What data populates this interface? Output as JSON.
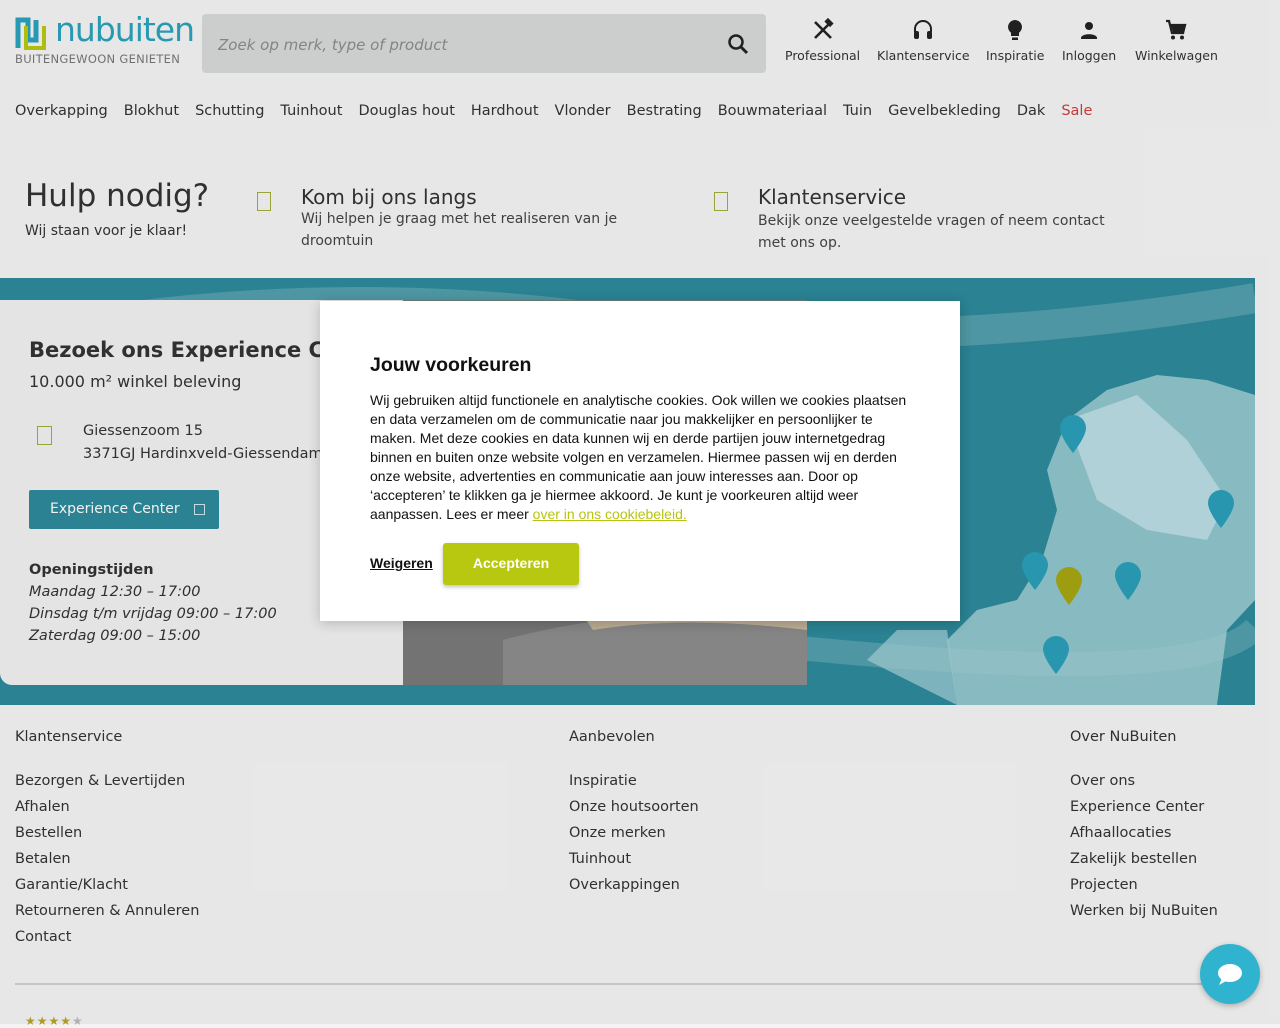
{
  "header": {
    "logo_text": "nubuiten",
    "logo_tagline": "BUITENGEWOON GENIETEN",
    "search_placeholder": "Zoek op merk, type of product",
    "items": [
      {
        "label": "Professional",
        "icon": "tools-icon"
      },
      {
        "label": "Klantenservice",
        "icon": "headset-icon"
      },
      {
        "label": "Inspiratie",
        "icon": "lightbulb-icon"
      },
      {
        "label": "Inloggen",
        "icon": "user-icon"
      },
      {
        "label": "Winkelwagen",
        "icon": "cart-icon"
      }
    ]
  },
  "nav": [
    "Overkapping",
    "Blokhut",
    "Schutting",
    "Tuinhout",
    "Douglas hout",
    "Hardhout",
    "Vlonder",
    "Bestrating",
    "Bouwmateriaal",
    "Tuin",
    "Gevelbekleding",
    "Dak",
    "Sale"
  ],
  "help": {
    "title": "Hulp nodig?",
    "subtitle": "Wij staan voor je klaar!",
    "visit_title": "Kom bij ons langs",
    "visit_text": "Wij helpen je graag met het realiseren van je droomtuin",
    "service_title": "Klantenservice",
    "service_text": "Bekijk onze veelgestelde vragen of neem contact met ons op."
  },
  "experience": {
    "title": "Bezoek ons Experience Center",
    "subtitle": "10.000 m² winkel beleving",
    "address_line1": "Giessenzoom 15",
    "address_line2": "3371GJ Hardinxveld-Giessendam",
    "button_label": "Experience Center",
    "hours_title": "Openingstijden",
    "hours": [
      "Maandag 12:30 – 17:00",
      "Dinsdag t/m vrijdag 09:00 – 17:00",
      "Zaterdag 09:00 – 15:00"
    ]
  },
  "footer": {
    "col1_title": "Klantenservice",
    "col1_links": [
      "Bezorgen & Levertijden",
      "Afhalen",
      "Bestellen",
      "Betalen",
      "Garantie/Klacht",
      "Retourneren & Annuleren",
      "Contact"
    ],
    "col2_title": "Aanbevolen",
    "col2_links": [
      "Inspiratie",
      "Onze houtsoorten",
      "Onze merken",
      "Tuinhout",
      "Overkappingen"
    ],
    "col3_title": "Over NuBuiten",
    "col3_links": [
      "Over ons",
      "Experience Center",
      "Afhaallocaties",
      "Zakelijk bestellen",
      "Projecten",
      "Werken bij NuBuiten"
    ],
    "rating": 4
  },
  "cookie": {
    "title": "Jouw voorkeuren",
    "text": "Wij gebruiken altijd functionele en analytische cookies. Ook willen we cookies plaatsen en data verzamelen om de communicatie naar jou makkelijker en persoonlijker te maken. Met deze cookies en data kunnen wij en derde partijen jouw internetgedrag binnen en buiten onze website volgen en verzamelen. Hiermee passen wij en derden onze website, advertenties en communicatie aan jouw interesses aan. Door op ‘accepteren’ te klikken ga je hiermee akkoord. Je kunt je voorkeuren altijd weer aanpassen. Lees er meer ",
    "link": "over in ons cookiebeleid.",
    "deny_label": "Weigeren",
    "accept_label": "Accepteren"
  },
  "colors": {
    "brand_blue": "#2aa3bb",
    "brand_green": "#b8c810",
    "band": "#2d8a9a",
    "sale": "#d23b3b"
  }
}
